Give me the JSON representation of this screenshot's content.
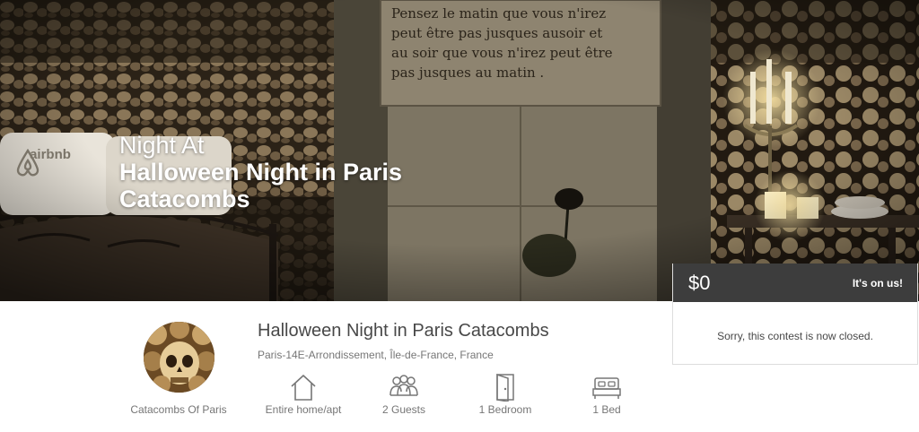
{
  "hero": {
    "title_prefix": "Night At",
    "title": "Halloween Night in Paris Catacombs",
    "plaque_lines": [
      "Pensez le matin que vous n'irez",
      "peut être pas jusques ausoir  et",
      "au soir que vous n'irez peut être",
      "pas  jusques au matin ."
    ],
    "pillow_brand": "airbnb"
  },
  "booking": {
    "price": "$0",
    "note": "It's on us!",
    "message": "Sorry, this contest is now closed."
  },
  "host": {
    "name": "Catacombs Of Paris"
  },
  "listing": {
    "title": "Halloween Night in Paris Catacombs",
    "location": "Paris-14E-Arrondissement, Île-de-France, France"
  },
  "amenities": [
    {
      "icon": "home-icon",
      "label": "Entire home/apt"
    },
    {
      "icon": "guests-icon",
      "label": "2 Guests"
    },
    {
      "icon": "door-icon",
      "label": "1 Bedroom"
    },
    {
      "icon": "bed-icon",
      "label": "1 Bed"
    }
  ],
  "colors": {
    "booking_header": "#3d3d3d",
    "text_dark": "#484848",
    "text_muted": "#767676"
  }
}
